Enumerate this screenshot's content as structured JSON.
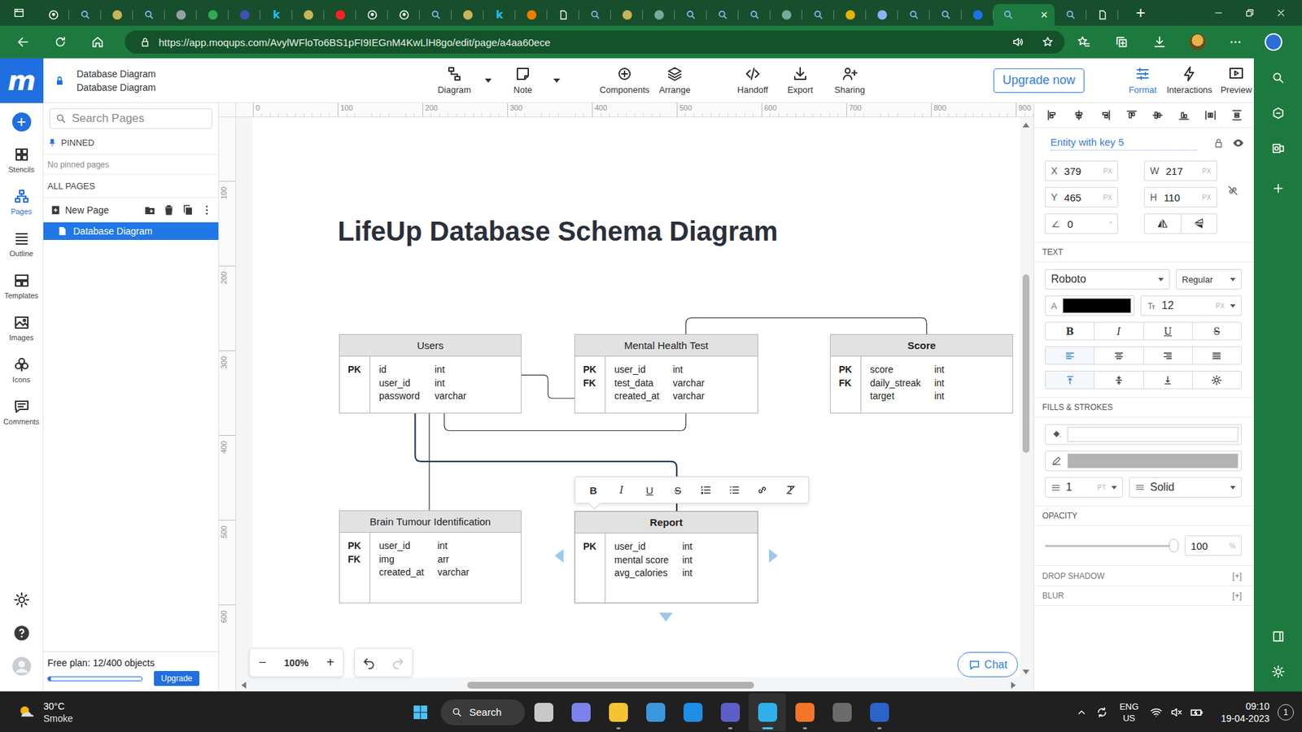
{
  "browser": {
    "tabs": [
      {
        "kind": "github",
        "selected": false
      },
      {
        "kind": "search",
        "selected": false
      },
      {
        "kind": "dot",
        "selected": false,
        "color": "#c9b458"
      },
      {
        "kind": "search",
        "selected": false
      },
      {
        "kind": "dot",
        "selected": false,
        "color": "#9aa0a6"
      },
      {
        "kind": "dot",
        "selected": false,
        "color": "#34a853"
      },
      {
        "kind": "dot",
        "selected": false,
        "color": "#3f51b5"
      },
      {
        "kind": "glyph",
        "selected": false,
        "color": "#20beff",
        "glyph": "k"
      },
      {
        "kind": "dot",
        "selected": false,
        "color": "#c9b458"
      },
      {
        "kind": "dot",
        "selected": false,
        "color": "#ff2020"
      },
      {
        "kind": "github",
        "selected": false
      },
      {
        "kind": "github",
        "selected": false
      },
      {
        "kind": "search",
        "selected": false
      },
      {
        "kind": "dot",
        "selected": false,
        "color": "#c9b458"
      },
      {
        "kind": "glyph",
        "selected": false,
        "color": "#20beff",
        "glyph": "k"
      },
      {
        "kind": "dot",
        "selected": false,
        "color": "#f57c00"
      },
      {
        "kind": "doc",
        "selected": false
      },
      {
        "kind": "search",
        "selected": false
      },
      {
        "kind": "dot",
        "selected": false,
        "color": "#c9b458"
      },
      {
        "kind": "dot",
        "selected": false,
        "color": "#74aa9c"
      },
      {
        "kind": "search",
        "selected": false
      },
      {
        "kind": "search",
        "selected": false
      },
      {
        "kind": "search",
        "selected": false
      },
      {
        "kind": "dot",
        "selected": false,
        "color": "#74aa9c"
      },
      {
        "kind": "search",
        "selected": false
      },
      {
        "kind": "dot",
        "selected": false,
        "color": "#e8b200"
      },
      {
        "kind": "dot",
        "selected": false,
        "color": "#8ab4f8"
      },
      {
        "kind": "search",
        "selected": false
      },
      {
        "kind": "search",
        "selected": false
      },
      {
        "kind": "dot",
        "selected": false,
        "color": "#1a73e8"
      },
      {
        "kind": "search",
        "selected": true
      },
      {
        "kind": "search",
        "selected": false
      },
      {
        "kind": "doc",
        "selected": false
      }
    ],
    "close_tab": "×",
    "new_tab": "+",
    "address": "https://app.moqups.com/AvylWFloTo6BS1pFI9IEGnM4KwLlH8go/edit/page/a4aa60ece"
  },
  "app": {
    "logo": "m",
    "document": {
      "title": "Database Diagram",
      "subtitle": "Database Diagram"
    },
    "tools": [
      {
        "label": "Diagram",
        "dropdown": true
      },
      {
        "label": "Note",
        "dropdown": true
      },
      {
        "label": "Components",
        "dropdown": false
      },
      {
        "label": "Arrange",
        "dropdown": false
      },
      {
        "label": "Handoff",
        "dropdown": false
      },
      {
        "label": "Export",
        "dropdown": false
      },
      {
        "label": "Sharing",
        "dropdown": false
      }
    ],
    "upgrade": "Upgrade now",
    "panel_tabs": [
      {
        "label": "Format",
        "selected": true
      },
      {
        "label": "Interactions",
        "selected": false
      },
      {
        "label": "Preview",
        "selected": false
      }
    ]
  },
  "rail": {
    "add": "+",
    "items": [
      {
        "label": "Stencils",
        "selected": false
      },
      {
        "label": "Pages",
        "selected": true
      },
      {
        "label": "Outline",
        "selected": false
      },
      {
        "label": "Templates",
        "selected": false
      },
      {
        "label": "Images",
        "selected": false
      },
      {
        "label": "Icons",
        "selected": false
      },
      {
        "label": "Comments",
        "selected": false
      }
    ]
  },
  "pages_panel": {
    "search_placeholder": "Search Pages",
    "pinned_title": "PINNED",
    "pinned_empty": "No pinned pages",
    "all_pages_title": "ALL PAGES",
    "new_page": "New Page",
    "pages": [
      {
        "title": "Database Diagram",
        "selected": true
      }
    ],
    "plan": {
      "label": "Free plan: 12/400 objects",
      "level": 0.03,
      "button": "Upgrade"
    }
  },
  "canvas": {
    "ruler_top": [
      "0",
      "100",
      "200",
      "300",
      "400",
      "500",
      "600",
      "700",
      "800",
      "900"
    ],
    "ruler_left": [
      "100",
      "200",
      "300",
      "400",
      "500",
      "600"
    ],
    "title": "LifeUp Database Schema Diagram",
    "entities": [
      {
        "name": "Users",
        "bold": false,
        "selected": false,
        "keys": [
          "PK"
        ],
        "fields": [
          {
            "name": "id",
            "type": "int"
          },
          {
            "name": "user_id",
            "type": "int"
          },
          {
            "name": "password",
            "type": "varchar"
          }
        ]
      },
      {
        "name": "Mental Health Test",
        "bold": false,
        "selected": false,
        "keys": [
          "PK",
          "FK"
        ],
        "fields": [
          {
            "name": "user_id",
            "type": "int"
          },
          {
            "name": "test_data",
            "type": "varchar"
          },
          {
            "name": "created_at",
            "type": "varchar"
          }
        ]
      },
      {
        "name": "Score",
        "bold": true,
        "selected": false,
        "keys": [
          "PK",
          "FK"
        ],
        "fields": [
          {
            "name": "score",
            "type": "int"
          },
          {
            "name": "daily_streak",
            "type": "int"
          },
          {
            "name": "target",
            "type": "int"
          }
        ]
      },
      {
        "name": "Brain Tumour Identification",
        "bold": false,
        "selected": false,
        "keys": [
          "PK",
          "FK"
        ],
        "fields": [
          {
            "name": "user_id",
            "type": "int"
          },
          {
            "name": "img",
            "type": "arr"
          },
          {
            "name": "created_at",
            "type": "varchar"
          }
        ]
      },
      {
        "name": "Report",
        "bold": true,
        "selected": true,
        "keys": [
          "PK"
        ],
        "fields": [
          {
            "name": "user_id",
            "type": "int"
          },
          {
            "name": "mental score",
            "type": "int"
          },
          {
            "name": "avg_calories",
            "type": "int"
          }
        ]
      }
    ],
    "text_toolbar": [
      "B",
      "I",
      "U",
      "S"
    ],
    "zoom": {
      "minus": "−",
      "level": "100%",
      "plus": "+"
    },
    "chat": "Chat"
  },
  "format_panel": {
    "element_name": "Entity with key 5",
    "geometry": [
      {
        "label": "X",
        "value": "379",
        "unit": "PX"
      },
      {
        "label": "W",
        "value": "217",
        "unit": "PX"
      },
      {
        "label": "Y",
        "value": "465",
        "unit": "PX"
      },
      {
        "label": "H",
        "value": "110",
        "unit": "PX"
      }
    ],
    "angle": {
      "value": "0",
      "unit": "°"
    },
    "text": {
      "title": "TEXT",
      "font": "Roboto",
      "weight": "Regular",
      "color_label": "A",
      "color": "#000000",
      "size": "12",
      "size_unit": "PX",
      "styles": [
        "B",
        "I",
        "U",
        "S"
      ],
      "align": [
        {
          "selected": true
        },
        {
          "selected": false
        },
        {
          "selected": false
        },
        {
          "selected": false
        }
      ],
      "valign": [
        {
          "selected": true
        },
        {
          "selected": false
        },
        {
          "selected": false
        }
      ]
    },
    "fills": {
      "title": "FILLS & STROKES",
      "fill": "#ffffff",
      "stroke": "#b3b3b3",
      "stroke_width": "1",
      "stroke_unit": "PT",
      "stroke_style": "Solid"
    },
    "opacity": {
      "title": "OPACITY",
      "level": 1,
      "value": "100",
      "unit": "%"
    },
    "sections": [
      {
        "title": "DROP SHADOW",
        "toggle": "[+]"
      },
      {
        "title": "BLUR",
        "toggle": "[+]"
      }
    ]
  },
  "taskbar": {
    "weather": {
      "temperature": "30°C",
      "condition": "Smoke"
    },
    "search": "Search",
    "apps": [
      {
        "selected": false,
        "running": false,
        "color": "#c8c8c8"
      },
      {
        "selected": false,
        "running": false,
        "color": "#7b83eb"
      },
      {
        "selected": false,
        "running": true,
        "color": "#f4c430"
      },
      {
        "selected": false,
        "running": false,
        "color": "#3a96dd"
      },
      {
        "selected": false,
        "running": false,
        "color": "#1f8ee5"
      },
      {
        "selected": false,
        "running": true,
        "color": "#5b5fc7"
      },
      {
        "selected": true,
        "running": true,
        "color": "#2fb0e8"
      },
      {
        "selected": false,
        "running": true,
        "color": "#f37626"
      },
      {
        "selected": false,
        "running": false,
        "color": "#6b6b6b"
      },
      {
        "selected": false,
        "running": true,
        "color": "#2b63c9"
      }
    ],
    "language": {
      "code": "ENG",
      "region": "US"
    },
    "time": "09:10",
    "date": "19-04-2023",
    "notifications": "1"
  }
}
